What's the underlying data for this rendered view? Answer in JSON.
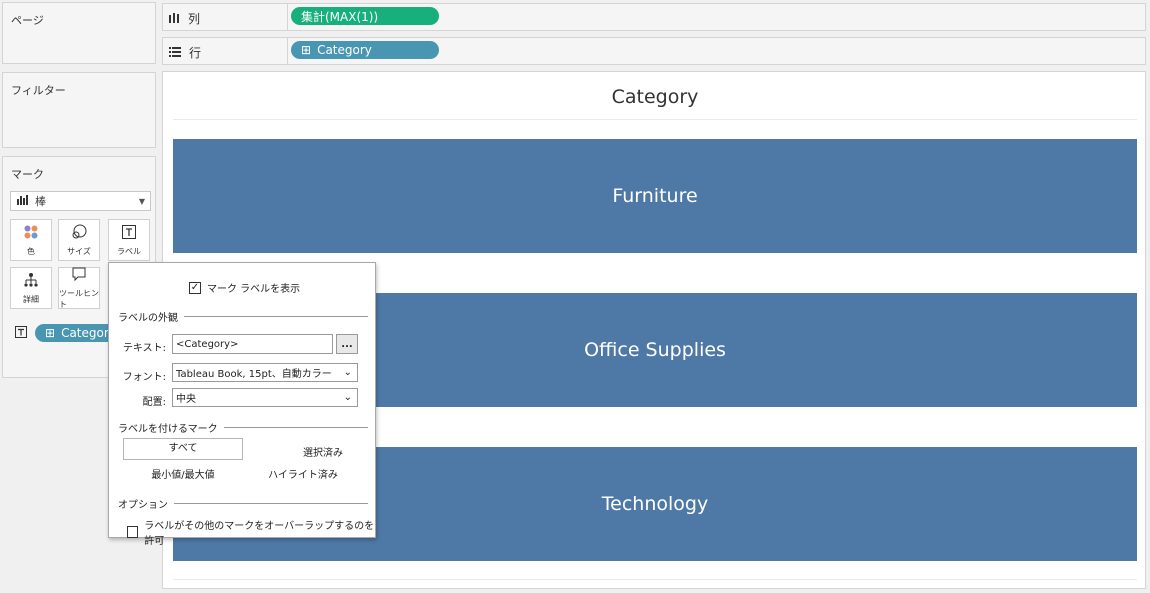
{
  "cards": {
    "pages": "ページ",
    "filters": "フィルター",
    "marks": "マーク"
  },
  "marks": {
    "type": "棒",
    "buttons": {
      "color": "色",
      "size": "サイズ",
      "label": "ラベル",
      "detail": "詳細",
      "tooltip": "ツールヒント"
    },
    "field": "Category"
  },
  "shelves": {
    "columns_label": "列",
    "columns_pill": "集計(MAX(1))",
    "rows_label": "行",
    "rows_pill": "Category"
  },
  "viz": {
    "title": "Category",
    "bars": [
      "Furniture",
      "Office Supplies",
      "Technology"
    ],
    "bar_color": "#4e79a7"
  },
  "popup": {
    "show_labels": "マーク ラベルを表示",
    "appearance_section": "ラベルの外観",
    "text_label": "テキスト:",
    "text_value": "<Category>",
    "more_button": "...",
    "font_label": "フォント:",
    "font_value": "Tableau Book, 15pt、自動カラー",
    "align_label": "配置:",
    "align_value": "中央",
    "marks_section": "ラベルを付けるマーク",
    "opt_all": "すべて",
    "opt_selected": "選択済み",
    "opt_minmax": "最小値/最大値",
    "opt_highlighted": "ハイライト済み",
    "options_section": "オプション",
    "overlap": "ラベルがその他のマークをオーバーラップするのを許可"
  },
  "colors": {
    "pill_blue": "#4996b2",
    "pill_green": "#17b07d"
  }
}
